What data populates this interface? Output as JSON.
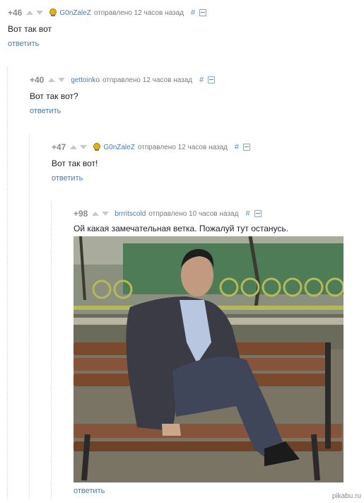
{
  "comments": [
    {
      "score": "+46",
      "user": "G0nZaleZ",
      "time": "отправлено 12 часов назад",
      "hash": "#",
      "text": "Вот так вот",
      "reply": "ответить",
      "avatar": "gold-coin-icon"
    },
    {
      "score": "+40",
      "user": "gettoinko",
      "time": "отправлено 12 часов назад",
      "hash": "#",
      "text": "Вот так вот?",
      "reply": "ответить"
    },
    {
      "score": "+47",
      "user": "G0nZaleZ",
      "time": "отправлено 12 часов назад",
      "hash": "#",
      "text": "Вот так вот!",
      "reply": "ответить",
      "avatar": "gold-coin-icon"
    },
    {
      "score": "+98",
      "user": "brrritscold",
      "time": "отправлено 10 часов назад",
      "hash": "#",
      "text": "Ой какая замечательная ветка. Пожалуй тут останусь.",
      "reply": "ответить"
    }
  ],
  "photo": {
    "description": "man-sitting-on-bench-photo"
  },
  "watermark": "pikabu.ru",
  "colors": {
    "link": "#4a7aa8",
    "score": "#8a8a8a",
    "meta": "#7a7a7a"
  }
}
